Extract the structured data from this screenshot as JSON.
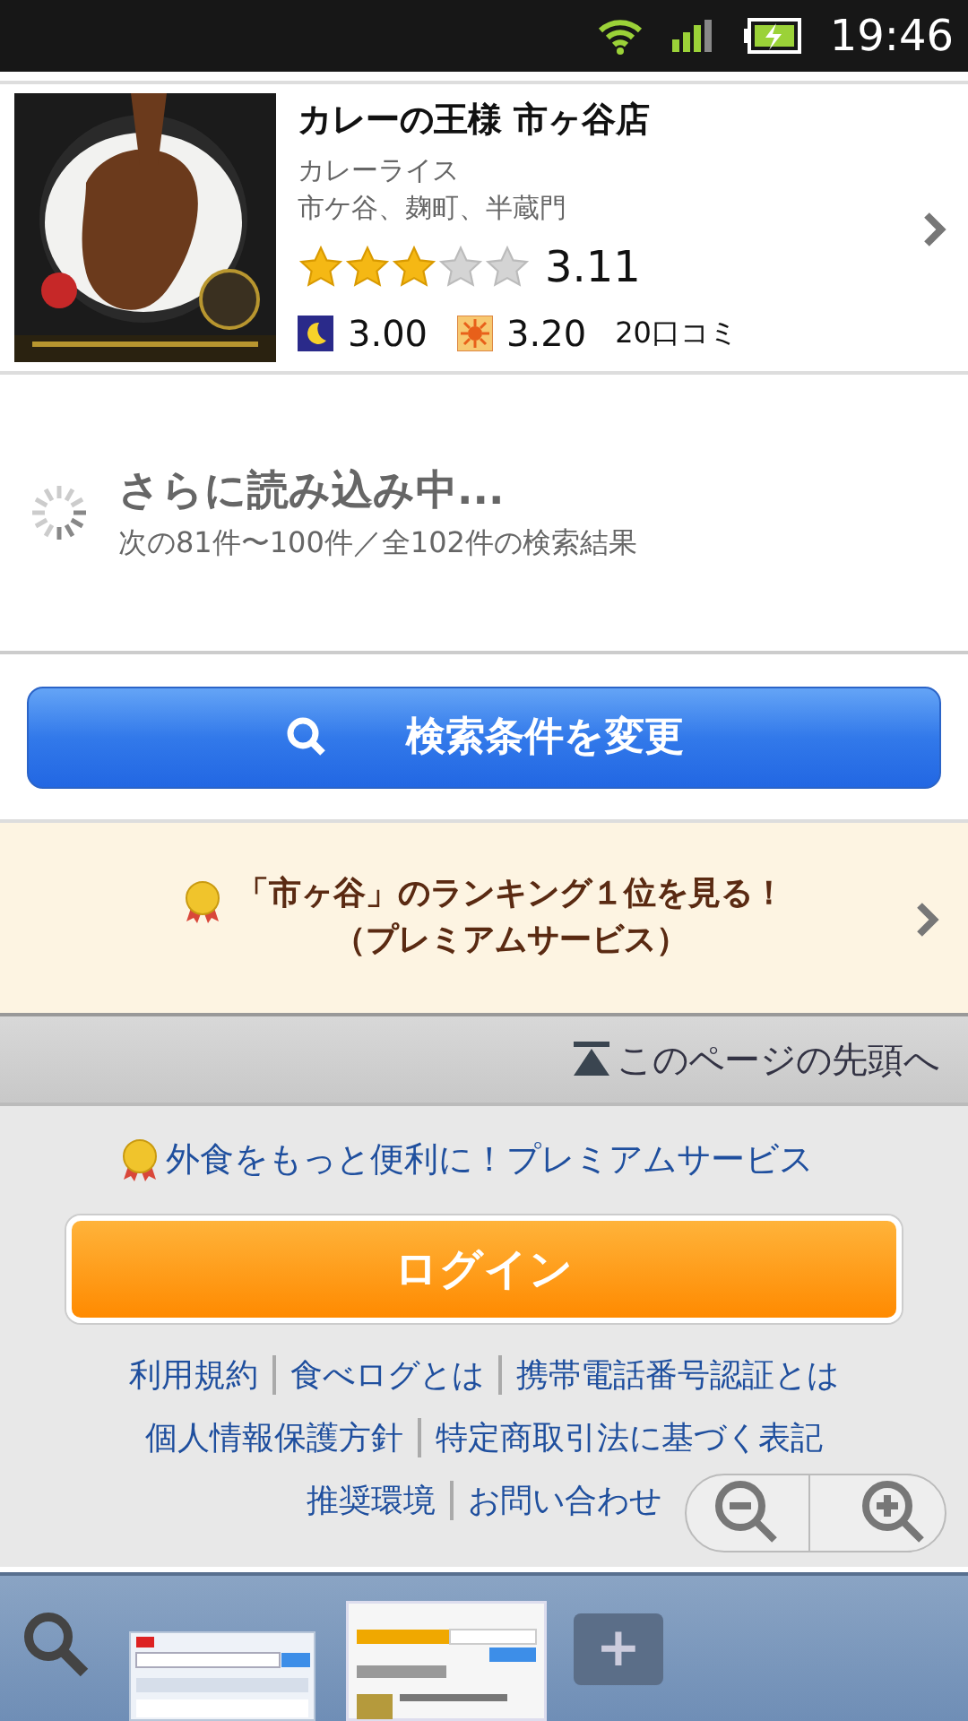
{
  "status_bar": {
    "time": "19:46"
  },
  "restaurant": {
    "name": "カレーの王様 市ヶ谷店",
    "genre": "カレーライス",
    "area": "市ケ谷、麹町、半蔵門",
    "stars": 3,
    "rating": "3.11",
    "night_rating": "3.00",
    "lunch_rating": "3.20",
    "reviews": "20口コミ"
  },
  "loading": {
    "title": "さらに読み込み中...",
    "detail": "次の81件〜100件／全102件の検索結果"
  },
  "search_button": {
    "label": "検索条件を変更"
  },
  "premium_banner": {
    "lines": [
      "「市ヶ谷」のランキング１位を見る！",
      "（プレミアムサービス）"
    ]
  },
  "back_to_top": {
    "label": "このページの先頭へ"
  },
  "footer": {
    "premium_link": "外食をもっと便利に！プレミアムサービス",
    "login_button": "ログイン",
    "link_rows": [
      [
        "利用規約",
        "食べログとは",
        "携帯電話番号認証とは"
      ],
      [
        "個人情報保護方針",
        "特定商取引法に基づく表記"
      ],
      [
        "推奨環境",
        "お問い合わせ"
      ]
    ]
  },
  "tab_bar": {
    "add_label": "+"
  }
}
